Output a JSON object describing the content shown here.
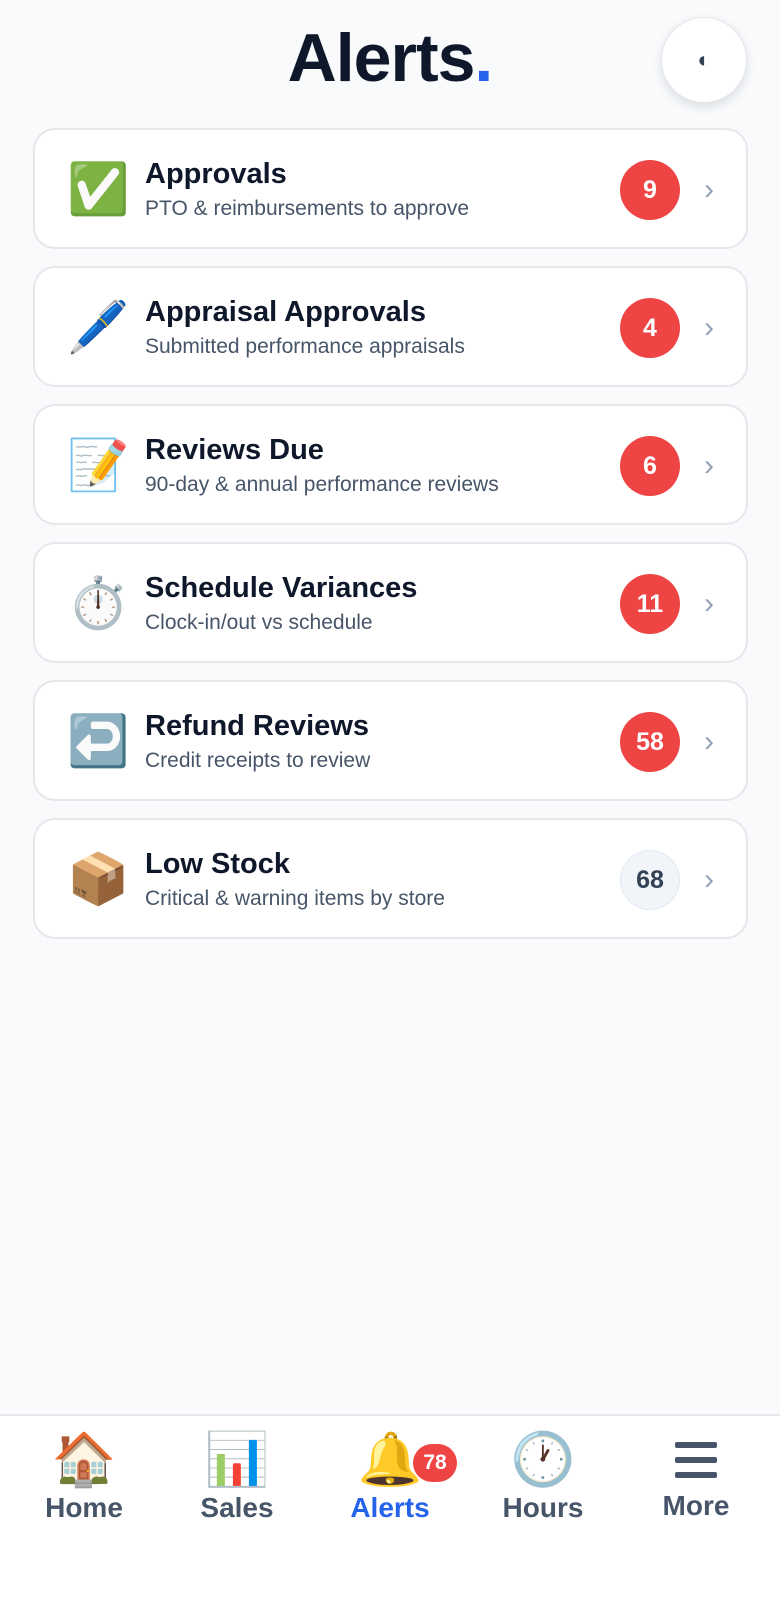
{
  "header": {
    "title": "Alerts",
    "title_dot": ".",
    "theme_toggle_glyph": "◐",
    "accent_color": "#2563eb"
  },
  "alerts": [
    {
      "icon": "✅",
      "icon_name": "check-mark-icon",
      "title": "Approvals",
      "subtitle": "PTO & reimbursements to approve",
      "count": "9",
      "style": "danger"
    },
    {
      "icon": "🖊️",
      "icon_name": "pen-icon",
      "title": "Appraisal Approvals",
      "subtitle": "Submitted performance appraisals",
      "count": "4",
      "style": "danger"
    },
    {
      "icon": "📝",
      "icon_name": "memo-icon",
      "title": "Reviews Due",
      "subtitle": "90-day & annual performance reviews",
      "count": "6",
      "style": "danger"
    },
    {
      "icon": "⏱️",
      "icon_name": "stopwatch-icon",
      "title": "Schedule Variances",
      "subtitle": "Clock-in/out vs schedule",
      "count": "11",
      "style": "danger"
    },
    {
      "icon": "↩️",
      "icon_name": "return-arrow-icon",
      "title": "Refund Reviews",
      "subtitle": "Credit receipts to review",
      "count": "58",
      "style": "danger"
    },
    {
      "icon": "📦",
      "icon_name": "package-icon",
      "title": "Low Stock",
      "subtitle": "Critical & warning items by store",
      "count": "68",
      "style": "neutral"
    }
  ],
  "chevron": "›",
  "tabs": [
    {
      "icon": "🏠",
      "icon_name": "house-icon",
      "label": "Home"
    },
    {
      "icon": "📊",
      "icon_name": "bar-chart-icon",
      "label": "Sales"
    },
    {
      "icon": "🔔",
      "icon_name": "bell-icon",
      "label": "Alerts",
      "badge": "78",
      "active": true
    },
    {
      "icon": "🕐",
      "icon_name": "clock-icon",
      "label": "Hours"
    },
    {
      "icon_name": "hamburger-menu-icon",
      "label": "More"
    }
  ],
  "colors": {
    "badge_danger": "#ef4444",
    "badge_neutral": "#f1f5f9",
    "active_tab": "#2563eb",
    "background": "#f8fafc"
  }
}
